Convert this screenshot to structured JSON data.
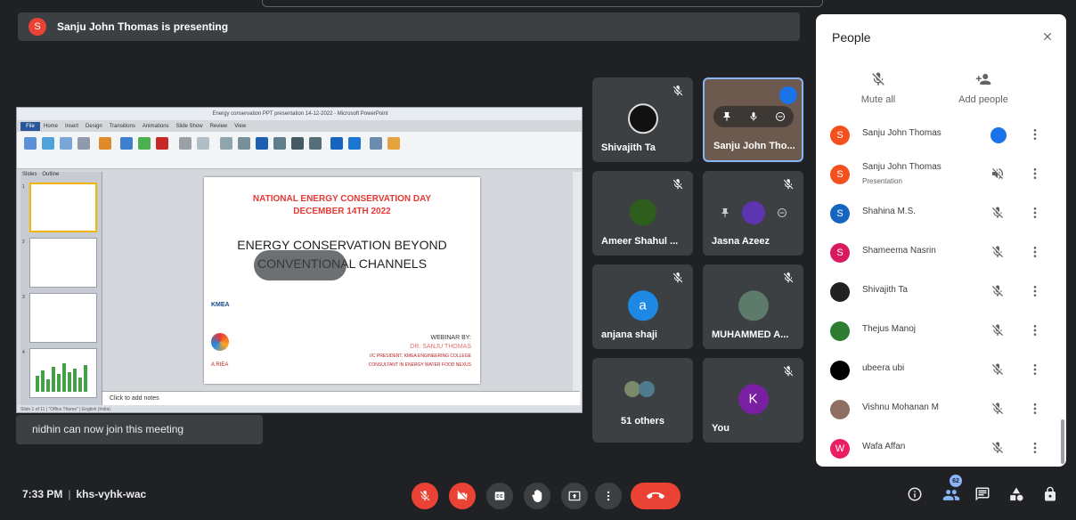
{
  "banner": {
    "avatar": "S",
    "text": "Sanju John Thomas is presenting"
  },
  "shared_screen": {
    "window_title": "Energy conservation PPT presentation 14-12-2022 - Microsoft PowerPoint",
    "file_tab": "File",
    "ribbon_tabs": [
      "Home",
      "Insert",
      "Design",
      "Transitions",
      "Animations",
      "Slide Show",
      "Review",
      "View"
    ],
    "thumb_tabs": [
      "Slides",
      "Outline"
    ],
    "slide_heading_1": "NATIONAL ENERGY CONSERVATION DAY",
    "slide_heading_2": "DECEMBER 14TH 2022",
    "slide_title_1": "ENERGY CONSERVATION BEYOND",
    "slide_title_2": "CONVENTIONAL CHANNELS",
    "webinar_by": "WEBINAR BY:",
    "presenter": "DR. SANJU THOMAS",
    "role_1": "I/C PRESIDENT, KMEA ENGINEERING COLLEGE",
    "role_2": "CONSULTANT IN ENERGY WATER FOOD NEXUS",
    "logo_kmea": "KMEA",
    "logo_ariea": "A RIEA",
    "notes_placeholder": "Click to add notes",
    "status": "Slide 1 of 11  |  \"Office Theme\"  |  English (India)"
  },
  "join_notice": "nidhin can now join this meeting",
  "tiles": [
    {
      "name": "Shivajith Ta",
      "muted": true
    },
    {
      "name": "Sanju John Tho...",
      "muted": false,
      "speaking": true
    },
    {
      "name": "Ameer Shahul ...",
      "muted": true
    },
    {
      "name": "Jasna Azeez",
      "muted": true
    },
    {
      "name": "anjana shaji",
      "avatar": "a",
      "color": "#1e88e5",
      "muted": true
    },
    {
      "name": "MUHAMMED A...",
      "muted": true
    },
    {
      "name": "51 others"
    },
    {
      "name": "You",
      "avatar": "K",
      "color": "#7b1fa2",
      "muted": true
    }
  ],
  "panel": {
    "title": "People",
    "mute_all": "Mute all",
    "add_people": "Add people",
    "people": [
      {
        "name": "Sanju John Thomas",
        "avatar": "S",
        "color": "#f4511e"
      },
      {
        "name": "Sanju John Thomas",
        "sub": "Presentation",
        "avatar": "S",
        "color": "#f4511e"
      },
      {
        "name": "Shahina M.S.",
        "avatar": "S",
        "color": "#1565c0"
      },
      {
        "name": "Shameema Nasrin",
        "avatar": "S",
        "color": "#d81b60"
      },
      {
        "name": "Shivajith Ta",
        "avatar": "",
        "color": "#212121"
      },
      {
        "name": "Thejus Manoj",
        "avatar": "",
        "color": "#2e7d32"
      },
      {
        "name": "ubeera ubi",
        "avatar": "",
        "color": "#000000"
      },
      {
        "name": "Vishnu Mohanan M",
        "avatar": "",
        "color": "#8d6e63"
      },
      {
        "name": "Wafa Affan",
        "avatar": "W",
        "color": "#e91e63"
      }
    ]
  },
  "bottom": {
    "time": "7:33 PM",
    "meeting_code": "khs-vyhk-wac",
    "people_count": "62"
  }
}
